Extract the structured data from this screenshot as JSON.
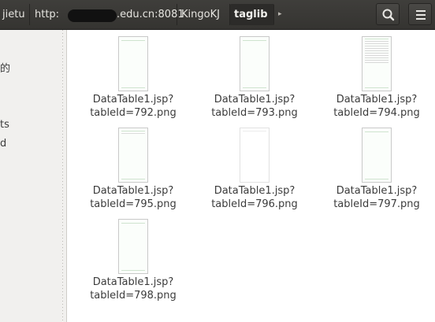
{
  "breadcrumbs": {
    "first": "jietu",
    "url_prefix": "http:",
    "url_suffix": ".edu.cn:8081",
    "third": "KingoKJ",
    "active": "taglib",
    "more": "▸"
  },
  "sidebar": {
    "fragments": [
      "的",
      "ts",
      "d"
    ]
  },
  "files": [
    {
      "line1": "DataTable1.jsp?",
      "line2": "tableId=792.png"
    },
    {
      "line1": "DataTable1.jsp?",
      "line2": "tableId=793.png"
    },
    {
      "line1": "DataTable1.jsp?",
      "line2": "tableId=794.png"
    },
    {
      "line1": "DataTable1.jsp?",
      "line2": "tableId=795.png"
    },
    {
      "line1": "DataTable1.jsp?",
      "line2": "tableId=796.png"
    },
    {
      "line1": "DataTable1.jsp?",
      "line2": "tableId=797.png"
    },
    {
      "line1": "DataTable1.jsp?",
      "line2": "tableId=798.png"
    }
  ]
}
